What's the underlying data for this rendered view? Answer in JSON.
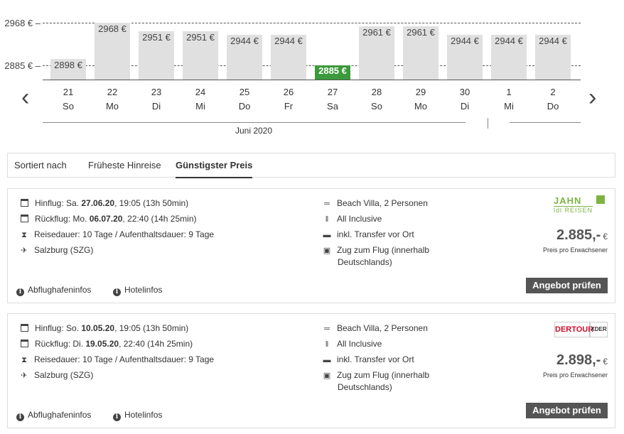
{
  "calendar": {
    "y_labels": {
      "top": "2968 € –",
      "bottom": "2885 € –"
    },
    "days": [
      {
        "date": "21",
        "weekday": "So",
        "price": 2898,
        "label": "2898 €"
      },
      {
        "date": "22",
        "weekday": "Mo",
        "price": 2968,
        "label": "2968 €"
      },
      {
        "date": "23",
        "weekday": "Di",
        "price": 2951,
        "label": "2951 €"
      },
      {
        "date": "24",
        "weekday": "Mi",
        "price": 2951,
        "label": "2951 €"
      },
      {
        "date": "25",
        "weekday": "Do",
        "price": 2944,
        "label": "2944 €"
      },
      {
        "date": "26",
        "weekday": "Fr",
        "price": 2944,
        "label": "2944 €"
      },
      {
        "date": "27",
        "weekday": "Sa",
        "price": 2885,
        "label": "2885 €",
        "best": true
      },
      {
        "date": "28",
        "weekday": "So",
        "price": 2961,
        "label": "2961 €"
      },
      {
        "date": "29",
        "weekday": "Mo",
        "price": 2961,
        "label": "2961 €"
      },
      {
        "date": "30",
        "weekday": "Di",
        "price": 2944,
        "label": "2944 €"
      },
      {
        "date": "1",
        "weekday": "Mi",
        "price": 2944,
        "label": "2944 €"
      },
      {
        "date": "2",
        "weekday": "Do",
        "price": 2944,
        "label": "2944 €"
      }
    ],
    "month_label": "Juni 2020",
    "prev_icon": "chevron-left-icon",
    "next_icon": "chevron-right-icon",
    "colors": {
      "bar": "#e0e0e0",
      "best_bar": "#3c9a3c"
    }
  },
  "sort": {
    "label": "Sortiert nach",
    "options": [
      {
        "label": "Früheste Hinreise",
        "active": false
      },
      {
        "label": "Günstigster Preis",
        "active": true
      }
    ]
  },
  "offers": [
    {
      "outbound_prefix": "Hinflug: Sa. ",
      "outbound_date": "27.06.20",
      "outbound_suffix": ", 19:05 (13h 50min)",
      "return_prefix": "Rückflug: Mo. ",
      "return_date": "06.07.20",
      "return_suffix": ", 22:40 (14h 25min)",
      "duration": "Reisedauer: 10 Tage / Aufenthaltsdauer: 9 Tage",
      "airport": "Salzburg (SZG)",
      "room": "Beach Villa, 2 Personen",
      "board": "All Inclusive",
      "transfer": "inkl. Transfer vor Ort",
      "train_line1": "Zug zum Flug (innerhalb",
      "train_line2": "Deutschlands)",
      "price": "2.885,-",
      "currency": "€",
      "price_note": "Preis pro Erwachsener",
      "button": "Angebot prüfen",
      "link_airport": "Abflughafeninfos",
      "link_hotel": "Hotelinfos",
      "operator": {
        "name": "JAHN",
        "subtitle": "REISEN",
        "tag": "ldl"
      }
    },
    {
      "outbound_prefix": "Hinflug: So. ",
      "outbound_date": "10.05.20",
      "outbound_suffix": ", 19:05 (13h 50min)",
      "return_prefix": "Rückflug: Di. ",
      "return_date": "19.05.20",
      "return_suffix": ", 22:40 (14h 25min)",
      "duration": "Reisedauer: 10 Tage / Aufenthaltsdauer: 9 Tage",
      "airport": "Salzburg (SZG)",
      "room": "Beach Villa, 2 Personen",
      "board": "All Inclusive",
      "transfer": "inkl. Transfer vor Ort",
      "train_line1": "Zug zum Flug (innerhalb",
      "train_line2": "Deutschlands)",
      "price": "2.898,-",
      "currency": "€",
      "price_note": "Preis pro Erwachsener",
      "button": "Angebot prüfen",
      "link_airport": "Abflughafeninfos",
      "link_hotel": "Hotelinfos",
      "operator": {
        "name": "DERTOUR",
        "subtitle": "XDER"
      }
    }
  ]
}
